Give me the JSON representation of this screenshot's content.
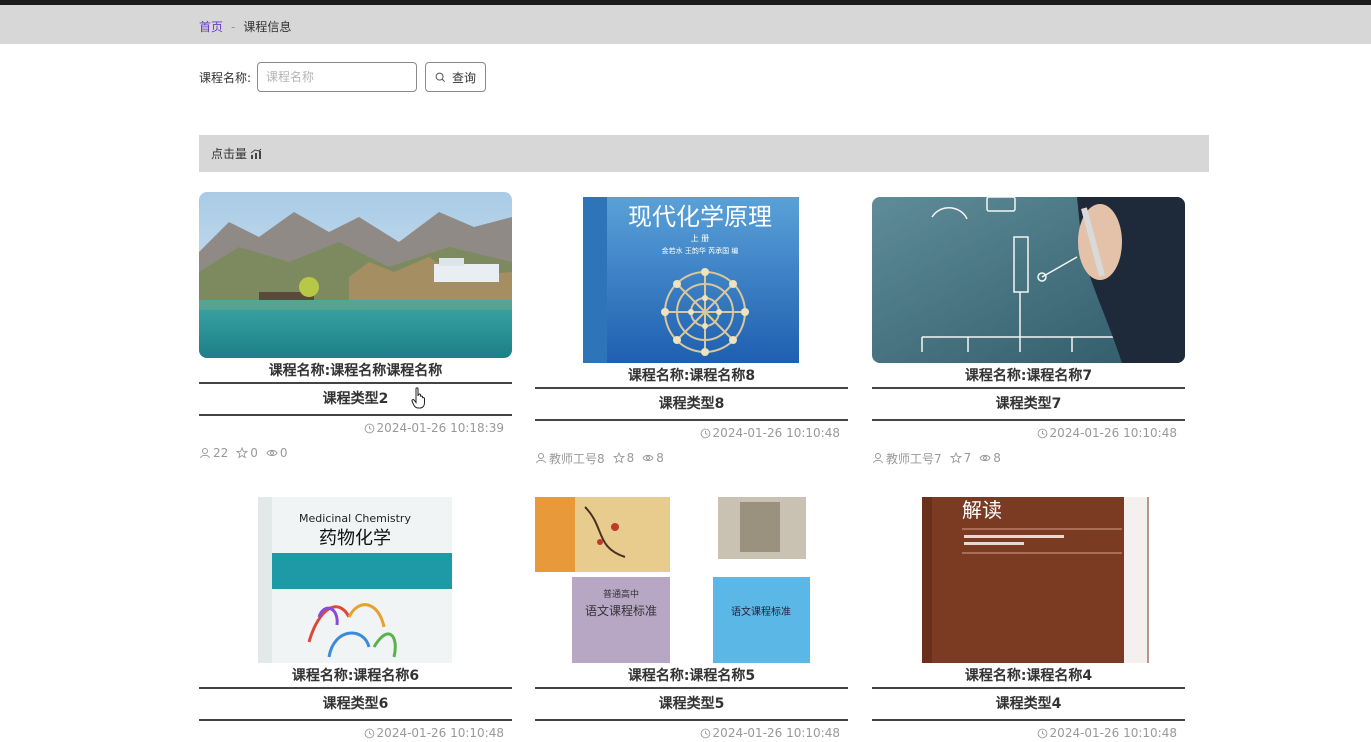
{
  "breadcrumb": {
    "home": "首页",
    "separator": "-",
    "current": "课程信息"
  },
  "search": {
    "label": "课程名称:",
    "placeholder": "课程名称",
    "value": "",
    "button": "查询"
  },
  "sort": {
    "label": "点击量"
  },
  "colors": {
    "accent": "#6a3bc7",
    "bar": "#d7d7d7",
    "meta": "#999999"
  },
  "cards": [
    {
      "title": "课程名称:课程名称课程名称",
      "type": "课程类型2",
      "time": "2024-01-26 10:18:39",
      "author": "22",
      "favorites": "0",
      "views": "0",
      "image": "mountain-lake-photo"
    },
    {
      "title": "课程名称:课程名称8",
      "type": "课程类型8",
      "time": "2024-01-26 10:10:48",
      "author": "教师工号8",
      "favorites": "8",
      "views": "8",
      "image": "modern-chemistry-book-cover"
    },
    {
      "title": "课程名称:课程名称7",
      "type": "课程类型7",
      "time": "2024-01-26 10:10:48",
      "author": "教师工号7",
      "favorites": "7",
      "views": "8",
      "image": "firewall-diagram-photo"
    },
    {
      "title": "课程名称:课程名称6",
      "type": "课程类型6",
      "time": "2024-01-26 10:10:48",
      "author": "",
      "favorites": "",
      "views": "",
      "image": "medicinal-chemistry-book-cover"
    },
    {
      "title": "课程名称:课程名称5",
      "type": "课程类型5",
      "time": "2024-01-26 10:10:48",
      "author": "",
      "favorites": "",
      "views": "",
      "image": "curriculum-books-photo"
    },
    {
      "title": "课程名称:课程名称4",
      "type": "课程类型4",
      "time": "2024-01-26 10:10:48",
      "author": "",
      "favorites": "",
      "views": "",
      "image": "curriculum-interpretation-book-cover"
    }
  ],
  "covers": {
    "chem_title": "现代化学原理",
    "chem_sub": "上 册",
    "chem_authors": "金若水  王韵华  芮承国  编",
    "med_en": "Medicinal Chemistry",
    "med_cn": "药物化学",
    "curr_title1": "普通高中",
    "curr_title2": "语文课程标准",
    "curr_title3": "语文课程标准",
    "interp_title": "解读"
  }
}
